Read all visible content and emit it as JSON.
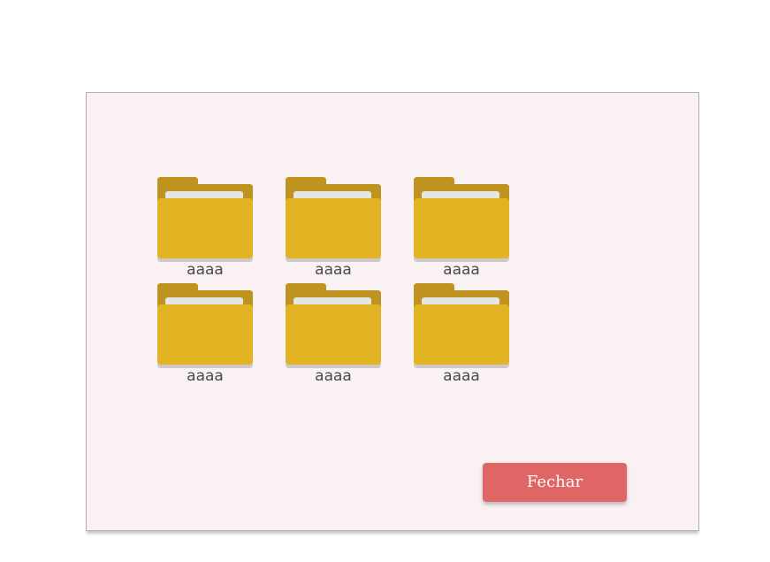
{
  "dialog": {
    "folders": [
      {
        "label": "aaaa",
        "icon": "folder-icon"
      },
      {
        "label": "aaaa",
        "icon": "folder-icon"
      },
      {
        "label": "aaaa",
        "icon": "folder-icon"
      },
      {
        "label": "aaaa",
        "icon": "folder-icon"
      },
      {
        "label": "aaaa",
        "icon": "folder-icon"
      },
      {
        "label": "aaaa",
        "icon": "folder-icon"
      }
    ],
    "close_label": "Fechar"
  },
  "colors": {
    "dialog_background": "#faf1f3",
    "folder_front": "#e2b424",
    "folder_back": "#bf9320",
    "folder_paper": "#e6e4df",
    "button": "#e06565",
    "button_text": "#ffffff"
  }
}
